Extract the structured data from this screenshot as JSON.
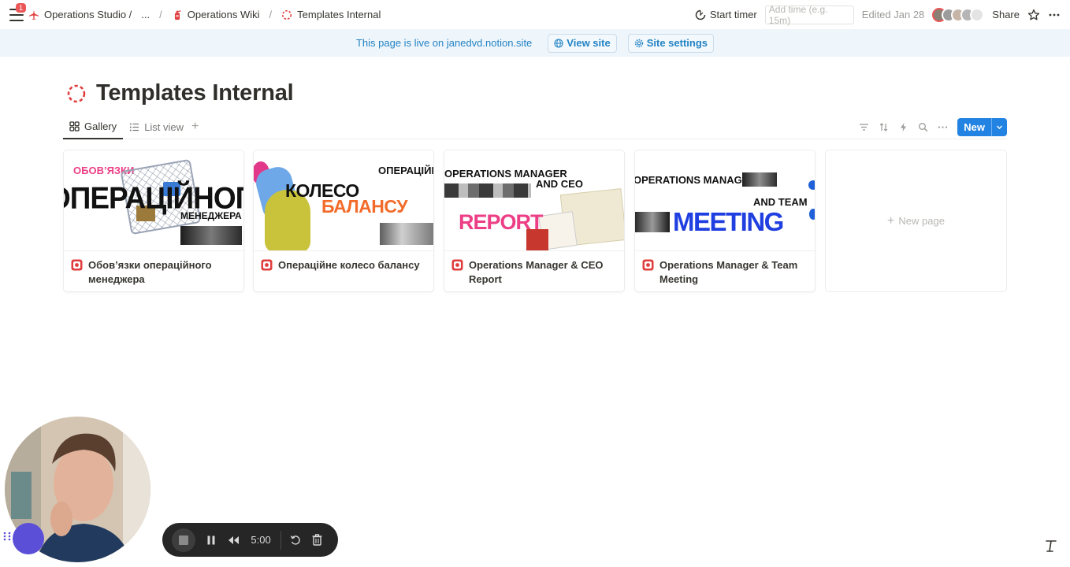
{
  "topbar": {
    "notif_count": "1",
    "breadcrumbs": [
      {
        "label": "Operations Studio /",
        "icon": "airplane-icon"
      },
      {
        "label": "...",
        "icon": ""
      },
      {
        "label": "Operations Wiki",
        "icon": "fire-extinguisher-icon"
      },
      {
        "label": "Templates Internal",
        "icon": "dashed-circle-icon"
      }
    ],
    "separator": "/",
    "start_timer": "Start timer",
    "time_placeholder": "Add time (e.g. 15m)",
    "edited": "Edited Jan 28",
    "share": "Share"
  },
  "banner": {
    "text": "This page is live on janedvd.notion.site",
    "view_site": "View site",
    "site_settings": "Site settings"
  },
  "page": {
    "title": "Templates Internal",
    "icon": "dashed-circle-icon"
  },
  "views": {
    "tabs": [
      {
        "label": "Gallery",
        "icon": "gallery-icon",
        "active": true
      },
      {
        "label": "List view",
        "icon": "list-icon",
        "active": false
      }
    ],
    "new_label": "New"
  },
  "gallery": {
    "cards": [
      {
        "title": "Обов’язки операційного менеджера",
        "cover_lines": [
          "ОБОВ’ЯЗКИ",
          "ОПЕРАЦІЙНОГО",
          "МЕНЕДЖЕРА"
        ]
      },
      {
        "title": "Операційне колесо балансу",
        "cover_lines": [
          "ОПЕРАЦІЙНЕ",
          "КОЛЕСО",
          "БАЛАНСУ"
        ]
      },
      {
        "title": "Operations Manager & CEO Report",
        "cover_lines": [
          "OPERATIONS MANAGER",
          "AND CEO",
          "REPORT"
        ]
      },
      {
        "title": "Operations Manager & Team Meeting",
        "cover_lines": [
          "OPERATIONS MANAGER",
          "AND TEAM",
          "MEETING"
        ]
      }
    ],
    "new_page": "New page"
  },
  "recorder": {
    "time": "5:00"
  },
  "colors": {
    "accent": "#2383e2",
    "banner_bg": "#eef5fb",
    "banner_text": "#2383c4",
    "icon_red": "#e03e3e",
    "cover_pink": "#ec3f86",
    "cover_orange": "#f26b2a",
    "cover_blue": "#1f3fe0"
  }
}
